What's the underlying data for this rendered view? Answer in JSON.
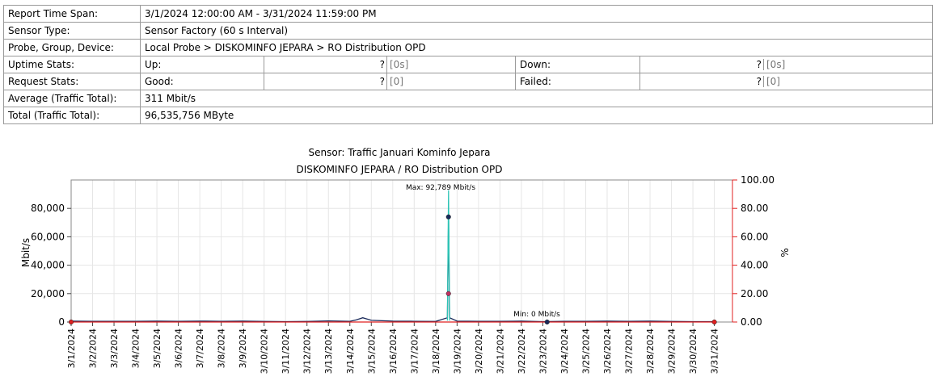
{
  "report": {
    "time_span_label": "Report Time Span:",
    "time_span_value": "3/1/2024 12:00:00 AM - 3/31/2024 11:59:00 PM",
    "sensor_type_label": "Sensor Type:",
    "sensor_type_value": "Sensor Factory (60 s Interval)",
    "probe_label": "Probe, Group, Device:",
    "probe_value": "Local Probe > DISKOMINFO JEPARA > RO Distribution OPD",
    "uptime_label": "Uptime Stats:",
    "up_label": "Up:",
    "up_value": "?",
    "up_extra": "[0s]",
    "down_label": "Down:",
    "down_value": "?",
    "down_extra": "[0s]",
    "request_label": "Request Stats:",
    "good_label": "Good:",
    "good_value": "?",
    "good_extra": "[0]",
    "failed_label": "Failed:",
    "failed_value": "?",
    "failed_extra": "[0]",
    "average_label": "Average (Traffic Total):",
    "average_value": "311 Mbit/s",
    "total_label": "Total (Traffic Total):",
    "total_value": "96,535,756 MByte"
  },
  "chart_data": {
    "type": "line",
    "title": "Sensor: Traffic Januari Kominfo Jepara",
    "subtitle": "DISKOMINFO JEPARA / RO Distribution OPD",
    "ylabel": "Mbit/s",
    "y2label": "%",
    "categories": [
      "3/1/2024",
      "3/2/2024",
      "3/3/2024",
      "3/4/2024",
      "3/5/2024",
      "3/6/2024",
      "3/7/2024",
      "3/8/2024",
      "3/9/2024",
      "3/10/2024",
      "3/11/2024",
      "3/12/2024",
      "3/13/2024",
      "3/14/2024",
      "3/15/2024",
      "3/16/2024",
      "3/17/2024",
      "3/18/2024",
      "3/19/2024",
      "3/20/2024",
      "3/21/2024",
      "3/22/2024",
      "3/23/2024",
      "3/24/2024",
      "3/25/2024",
      "3/26/2024",
      "3/27/2024",
      "3/28/2024",
      "3/29/2024",
      "3/30/2024",
      "3/31/2024"
    ],
    "yticks": [
      "0",
      "20,000",
      "40,000",
      "60,000",
      "80,000"
    ],
    "y2ticks": [
      "0.00",
      "20.00",
      "40.00",
      "60.00",
      "80.00",
      "100.00"
    ],
    "ylim": [
      0,
      100000
    ],
    "y2lim": [
      0,
      100
    ],
    "grid": true,
    "annotations": {
      "max": "Max: 92,789 Mbit/s",
      "min": "Min: 0 Mbit/s"
    },
    "max_value": 92789,
    "min_value": 0,
    "series": [
      {
        "color": "#1a2a5a",
        "x": [
          1.0,
          2.0,
          4.0,
          5.0,
          6.0,
          7.0,
          8.0,
          9.0,
          10.0,
          11.0,
          12.0,
          13.0,
          14.0,
          14.3,
          14.6,
          15.0,
          16.0,
          17.0,
          18.0,
          18.55,
          18.6,
          18.65,
          19.0,
          20.0,
          21.0,
          22.0,
          23.0,
          24.0,
          25.0,
          26.0,
          27.0,
          28.0,
          29.0,
          30.0,
          31.0
        ],
        "y": [
          600,
          500,
          500,
          600,
          500,
          600,
          500,
          600,
          400,
          300,
          400,
          800,
          500,
          1500,
          3000,
          1200,
          600,
          500,
          400,
          3000,
          74000,
          3000,
          600,
          500,
          500,
          600,
          300,
          500,
          500,
          600,
          500,
          600,
          400,
          300,
          300
        ]
      },
      {
        "color": "#2ec4b6",
        "x": [
          18.55,
          18.6,
          18.65
        ],
        "y": [
          1000,
          92789,
          1000
        ]
      },
      {
        "color": "#e02020",
        "x": [
          1.0,
          31.0
        ],
        "y": [
          0,
          0
        ]
      }
    ],
    "markers": [
      {
        "x": 18.6,
        "y": 74000,
        "color": "#1a2a5a"
      },
      {
        "x": 18.6,
        "y": 20000,
        "color": "#c03060"
      },
      {
        "x": 23.2,
        "y": 0,
        "color": "#1a2a5a"
      },
      {
        "x": 1.0,
        "y": 0,
        "color": "#e02020"
      },
      {
        "x": 31.0,
        "y": 0,
        "color": "#e02020"
      }
    ]
  }
}
